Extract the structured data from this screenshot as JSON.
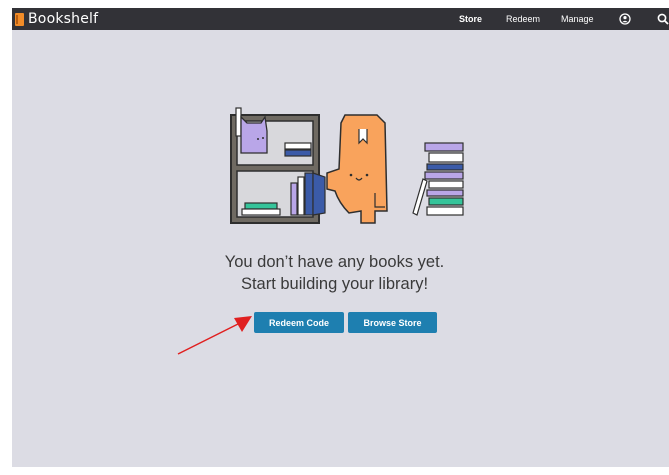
{
  "app": {
    "title": "Bookshelf"
  },
  "nav": {
    "store": "Store",
    "redeem": "Redeem",
    "manage": "Manage"
  },
  "icons": {
    "brand": "book-icon",
    "account": "account-icon",
    "search": "search-icon"
  },
  "empty_state": {
    "line1": "You don’t have any books yet.",
    "line2": "Start building your library!"
  },
  "actions": {
    "redeem_code": "Redeem Code",
    "browse_store": "Browse Store"
  },
  "colors": {
    "topbar": "#323237",
    "background": "#dcdce4",
    "button": "#1e7fb0",
    "brand_icon": "#f28c28",
    "annotation_arrow": "#e02020"
  }
}
